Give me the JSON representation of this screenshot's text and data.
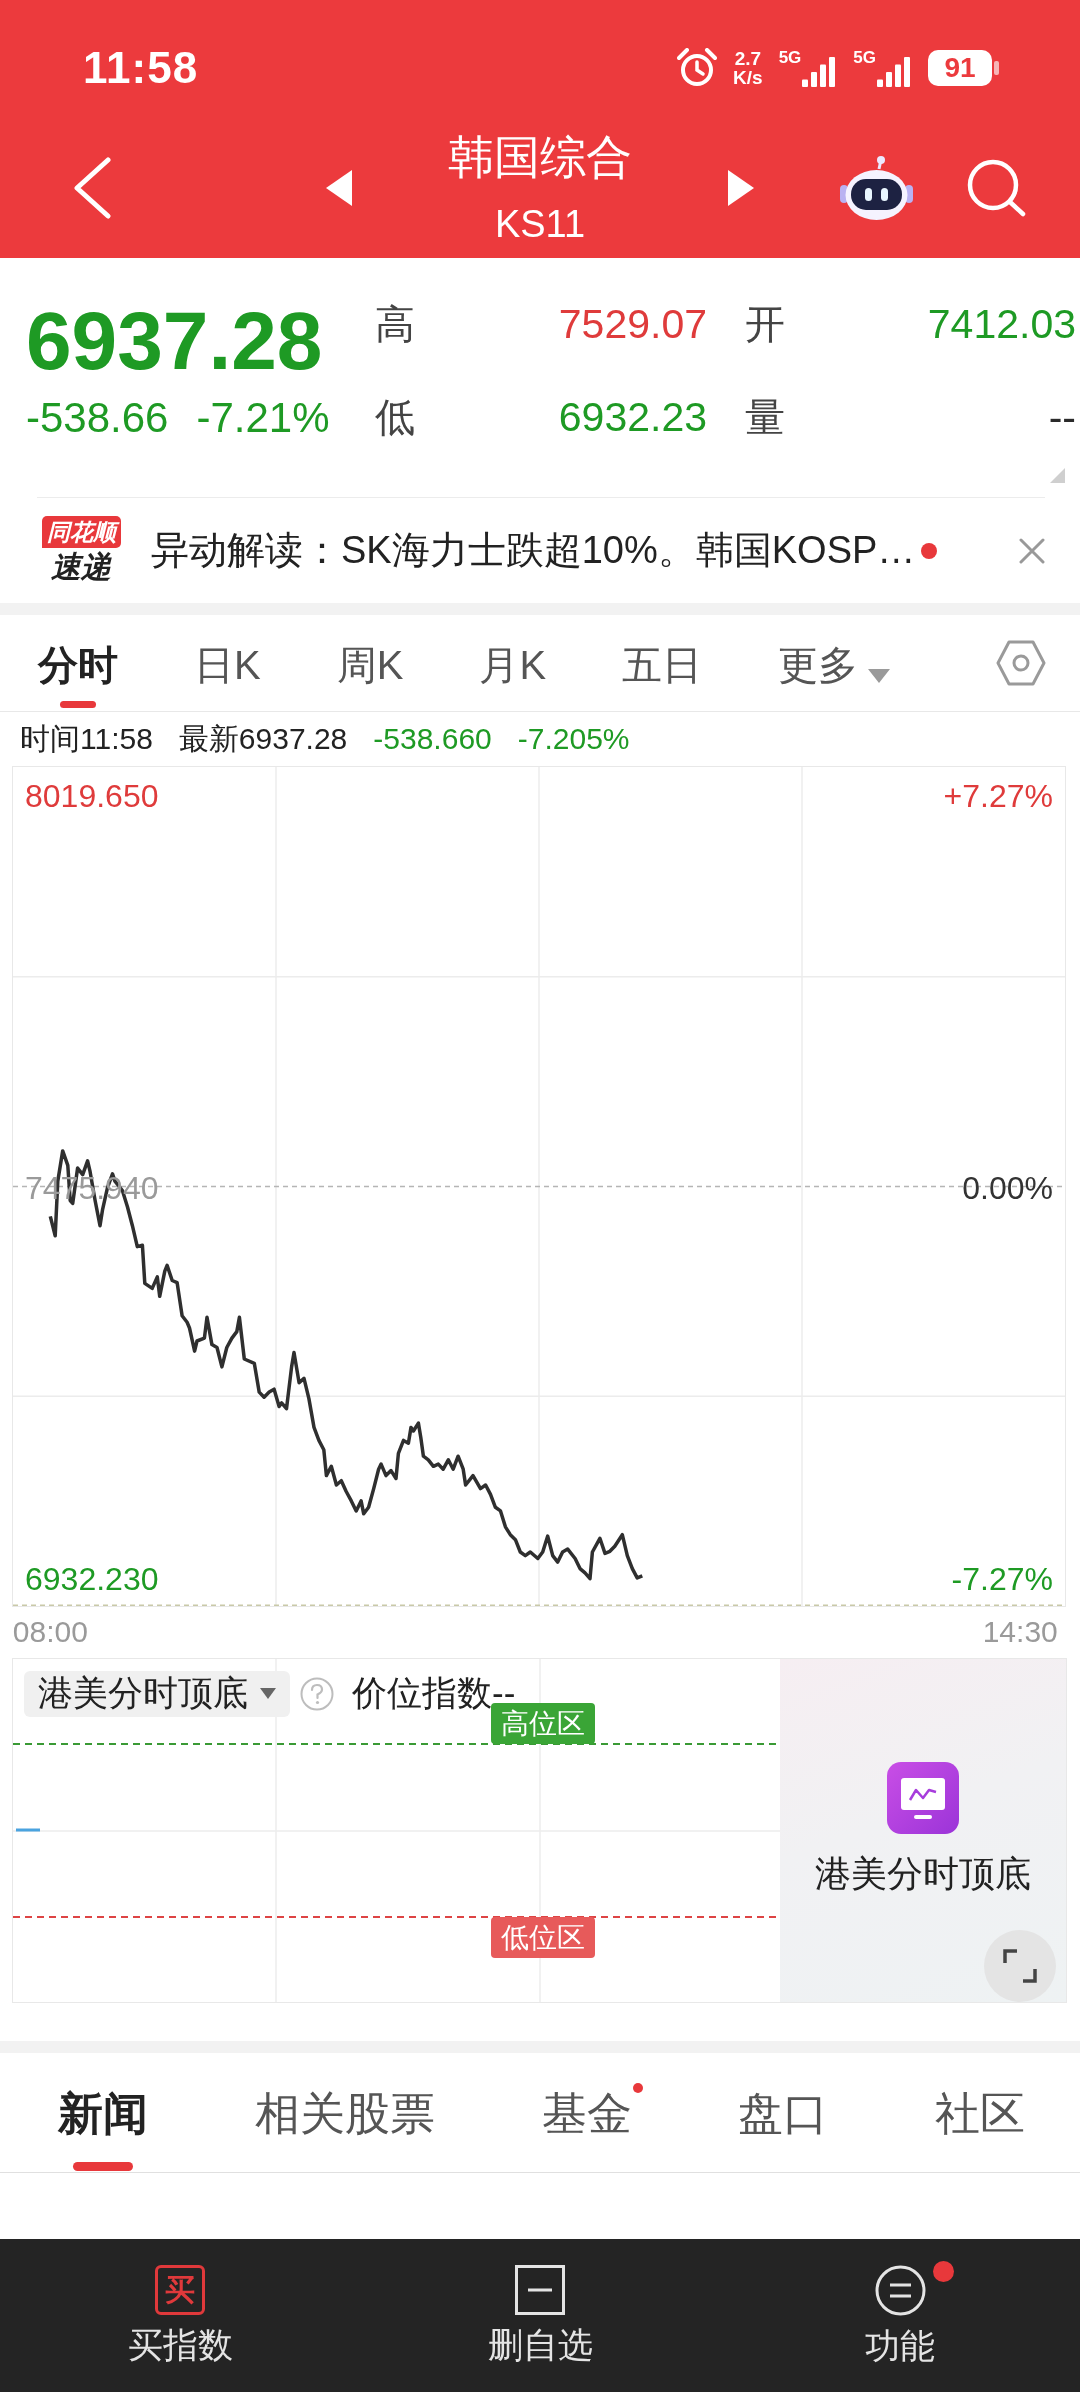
{
  "status_bar": {
    "time": "11:58",
    "net_speed": "2.7",
    "net_unit": "K/s",
    "network_labels": [
      "5G",
      "5G"
    ],
    "battery": "91"
  },
  "header": {
    "title": "韩国综合",
    "code": "KS11"
  },
  "quote": {
    "price": "6937.28",
    "change": "-538.66",
    "change_pct": "-7.21%",
    "color": "#1e9a24",
    "stats": [
      {
        "label": "高",
        "value": "7529.07",
        "color": "#df3b3b"
      },
      {
        "label": "开",
        "value": "7412.03",
        "color": "#1e9a24"
      },
      {
        "label": "低",
        "value": "6932.23",
        "color": "#1e9a24"
      },
      {
        "label": "量",
        "value": "--",
        "color": "#2a2a2a"
      }
    ]
  },
  "news_ticker": {
    "logo_top": "同花顺",
    "logo_bottom": "速递",
    "text": "异动解读：SK海力士跌超10%。韩国KOSP…",
    "unread": true
  },
  "chart_tabs": [
    {
      "label": "分时",
      "selected": true,
      "dropdown": false
    },
    {
      "label": "日K",
      "selected": false,
      "dropdown": false
    },
    {
      "label": "周K",
      "selected": false,
      "dropdown": false
    },
    {
      "label": "月K",
      "selected": false,
      "dropdown": false
    },
    {
      "label": "五日",
      "selected": false,
      "dropdown": false
    },
    {
      "label": "更多",
      "selected": false,
      "dropdown": true
    }
  ],
  "intraday": {
    "info": [
      {
        "text": "时间11:58",
        "color": "#222222"
      },
      {
        "text": "最新6937.28",
        "color": "#222222"
      },
      {
        "text": "-538.660",
        "color": "#1e9a24"
      },
      {
        "text": "-7.205%",
        "color": "#1e9a24"
      }
    ],
    "price_labels": [
      {
        "color": "#df3b3b"
      },
      {
        "color": "#9a9a9a"
      },
      {
        "color": "#1e9a24"
      }
    ],
    "percent_labels": [
      {
        "text": "+7.27%",
        "color": "#df3b3b"
      },
      {
        "text": "0.00%",
        "color": "#333333"
      },
      {
        "text": "-7.27%",
        "color": "#1e9a24"
      }
    ],
    "chart_data": {
      "type": "line",
      "x": [
        8,
        8.033,
        8.05,
        8.083,
        8.117,
        8.133,
        8.15,
        8.183,
        8.217,
        8.25,
        8.267,
        8.3,
        8.333,
        8.35,
        8.383,
        8.417,
        8.433,
        8.483,
        8.517,
        8.55,
        8.583,
        8.617,
        8.633,
        8.683,
        8.717,
        8.733,
        8.767,
        8.783,
        8.817,
        8.85,
        8.883,
        8.917,
        8.933,
        8.967,
        8.983,
        9.033,
        9.05,
        9.083,
        9.117,
        9.15,
        9.183,
        9.217,
        9.25,
        9.267,
        9.3,
        9.367,
        9.4,
        9.433,
        9.467,
        9.5,
        9.533,
        9.55,
        9.583,
        9.617,
        9.633,
        9.667,
        9.7,
        9.733,
        9.767,
        9.8,
        9.833,
        9.85,
        9.883,
        9.917,
        9.95,
        9.983,
        10.017,
        10.05,
        10.083,
        10.1,
        10.133,
        10.167,
        10.2,
        10.217,
        10.25,
        10.283,
        10.317,
        10.333,
        10.367,
        10.4,
        10.417,
        10.433,
        10.467,
        10.483,
        10.5,
        10.533,
        10.567,
        10.6,
        10.633,
        10.667,
        10.7,
        10.733,
        10.767,
        10.783,
        10.833,
        10.883,
        10.917,
        10.95,
        10.983,
        11.017,
        11.05,
        11.083,
        11.117,
        11.15,
        11.183,
        11.217,
        11.267,
        11.3,
        11.333,
        11.367,
        11.4,
        11.433,
        11.467,
        11.517,
        11.55,
        11.583,
        11.617,
        11.633,
        11.683,
        11.717,
        11.75,
        11.783,
        11.833,
        11.867,
        11.9,
        11.933,
        11.967
      ],
      "values": [
        7436,
        7409,
        7485,
        7527,
        7507,
        7458,
        7454,
        7503,
        7494,
        7513,
        7498,
        7458,
        7423,
        7445,
        7476,
        7495,
        7485,
        7472,
        7449,
        7423,
        7394,
        7396,
        7343,
        7336,
        7352,
        7325,
        7360,
        7368,
        7347,
        7344,
        7298,
        7289,
        7281,
        7249,
        7263,
        7267,
        7296,
        7258,
        7254,
        7227,
        7254,
        7267,
        7276,
        7296,
        7238,
        7232,
        7192,
        7185,
        7192,
        7196,
        7172,
        7177,
        7169,
        7227,
        7247,
        7205,
        7211,
        7183,
        7143,
        7125,
        7112,
        7076,
        7089,
        7063,
        7069,
        7054,
        7041,
        7027,
        7041,
        7023,
        7032,
        7058,
        7085,
        7092,
        7076,
        7083,
        7072,
        7107,
        7125,
        7121,
        7143,
        7138,
        7149,
        7129,
        7103,
        7098,
        7089,
        7092,
        7085,
        7098,
        7085,
        7103,
        7085,
        7063,
        7076,
        7058,
        7063,
        7050,
        7032,
        7027,
        7005,
        6994,
        6987,
        6970,
        6965,
        6970,
        6961,
        6970,
        6992,
        6965,
        6956,
        6970,
        6974,
        6961,
        6947,
        6941,
        6933,
        6970,
        6989,
        6968,
        6971,
        6978,
        6994,
        6965,
        6947,
        6934,
        6937
      ],
      "xlim": [
        7.75,
        14.8
      ],
      "ylim": [
        6895,
        8060
      ],
      "xticks": [
        {
          "value": 8,
          "label": "08:00"
        },
        {
          "value": 14.5,
          "label": "14:30"
        }
      ],
      "yticks": [
        {
          "value": 8019.65,
          "label": "8019.650"
        },
        {
          "value": 7475.94,
          "label": "7475.940"
        },
        {
          "value": 6932.23,
          "label": "6932.230"
        }
      ]
    }
  },
  "indicator": {
    "selector": "港美分时顶底",
    "reading": "价位指数--",
    "high_zone": "高位区",
    "low_zone": "低位区",
    "promo": "港美分时顶底"
  },
  "news_tabs": [
    {
      "label": "新闻",
      "selected": true,
      "badge": false
    },
    {
      "label": "相关股票",
      "selected": false,
      "badge": false
    },
    {
      "label": "基金",
      "selected": false,
      "badge": true
    },
    {
      "label": "盘口",
      "selected": false,
      "badge": false
    },
    {
      "label": "社区",
      "selected": false,
      "badge": false
    }
  ],
  "bottom_nav": [
    {
      "kind": "buy",
      "icon_text": "买",
      "label": "买指数",
      "badge": false
    },
    {
      "kind": "remove",
      "label": "删自选",
      "badge": false
    },
    {
      "kind": "menu",
      "label": "功能",
      "badge": true
    }
  ]
}
